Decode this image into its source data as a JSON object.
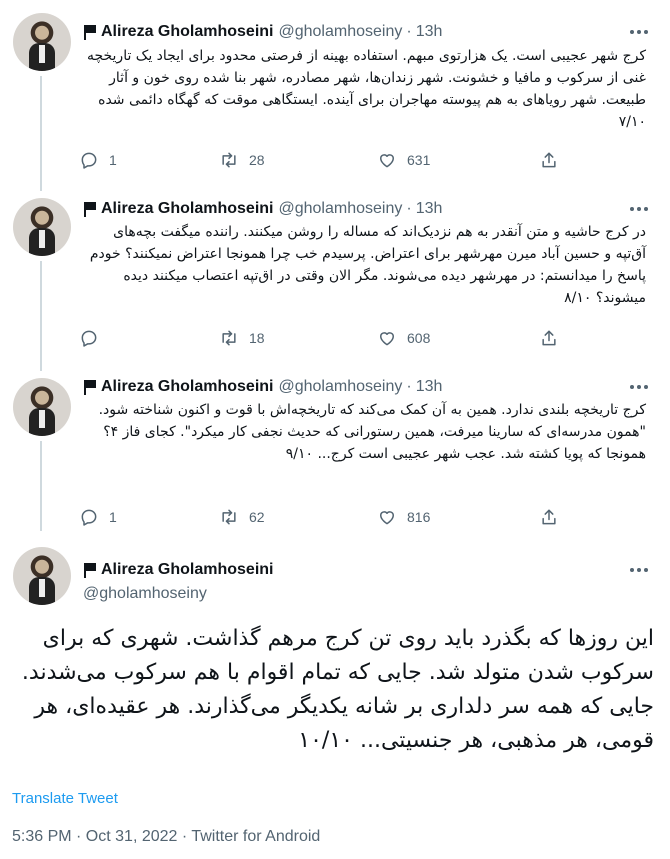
{
  "author": {
    "name": "Alireza Gholamhoseini",
    "handle": "@gholamhoseiny"
  },
  "tweets": [
    {
      "time": "13h",
      "text": "کرج شهر عجیبی است. یک هزارتوی مبهم. استفاده بهینه از فرصتی محدود برای ایجاد یک تاریخچه غنی از سرکوب و مافیا و خشونت. شهر زندان‌ها، شهر مصادره، شهر بنا شده روی خون و آثار طبیعت. شهر رویاهای به هم پیوسته مهاجران برای آینده. ایستگاهی موقت که گهگاه دائمی شده ۷/۱۰",
      "replies": "1",
      "retweets": "28",
      "likes": "631"
    },
    {
      "time": "13h",
      "text": "در کرج حاشیه و متن آنقدر به هم نزدیک‌اند که مساله را روشن میکنند. راننده میگفت بچه‌های آق‌تپه و حسین آباد میرن مهرشهر برای اعتراض. پرسیدم خب چرا همونجا اعتراض نمیکنند؟ خودم پاسخ را میدانستم: در مهرشهر دیده می‌شوند. مگر الان وقتی در اق‌تپه اعتصاب میکنند دیده میشوند؟ ۸/۱۰",
      "replies": "",
      "retweets": "18",
      "likes": "608"
    },
    {
      "time": "13h",
      "text": "کرج تاریخچه بلندی ندارد. همین به آن کمک می‌کند که تاریخچه‌اش با قوت و اکنون شناخته شود. \"همون مدرسه‌ای که سارینا میرفت، همین رستورانی که حدیث نجفی کار میکرد\". کجای فاز ۴؟ همونجا که پویا کشته شد. عجب شهر عجیبی است کرج... ۹/۱۰",
      "replies": "1",
      "retweets": "62",
      "likes": "816"
    }
  ],
  "main_tweet": {
    "text": "این روزها که بگذرد باید روی تن کرج مرهم گذاشت. شهری که برای سرکوب شدن متولد شد. جایی که تمام اقوام با هم سرکوب می‌شدند. جایی که همه سر دلداری بر شانه یکدیگر می‌گذارند. هر عقیده‌ای، هر قومی، هر مذهبی، هر جنسیتی... ۱۰/۱۰",
    "translate_label": "Translate Tweet",
    "timestamp": "5:36 PM · Oct 31, 2022 · Twitter for Android"
  },
  "separator": "·",
  "icons": {
    "reply": "reply-icon",
    "retweet": "retweet-icon",
    "like": "like-icon",
    "share": "share-icon",
    "more": "more-icon",
    "flag": "flag-icon"
  },
  "colors": {
    "link": "#1d9bf0",
    "muted": "#536471",
    "text": "#0f1419"
  }
}
